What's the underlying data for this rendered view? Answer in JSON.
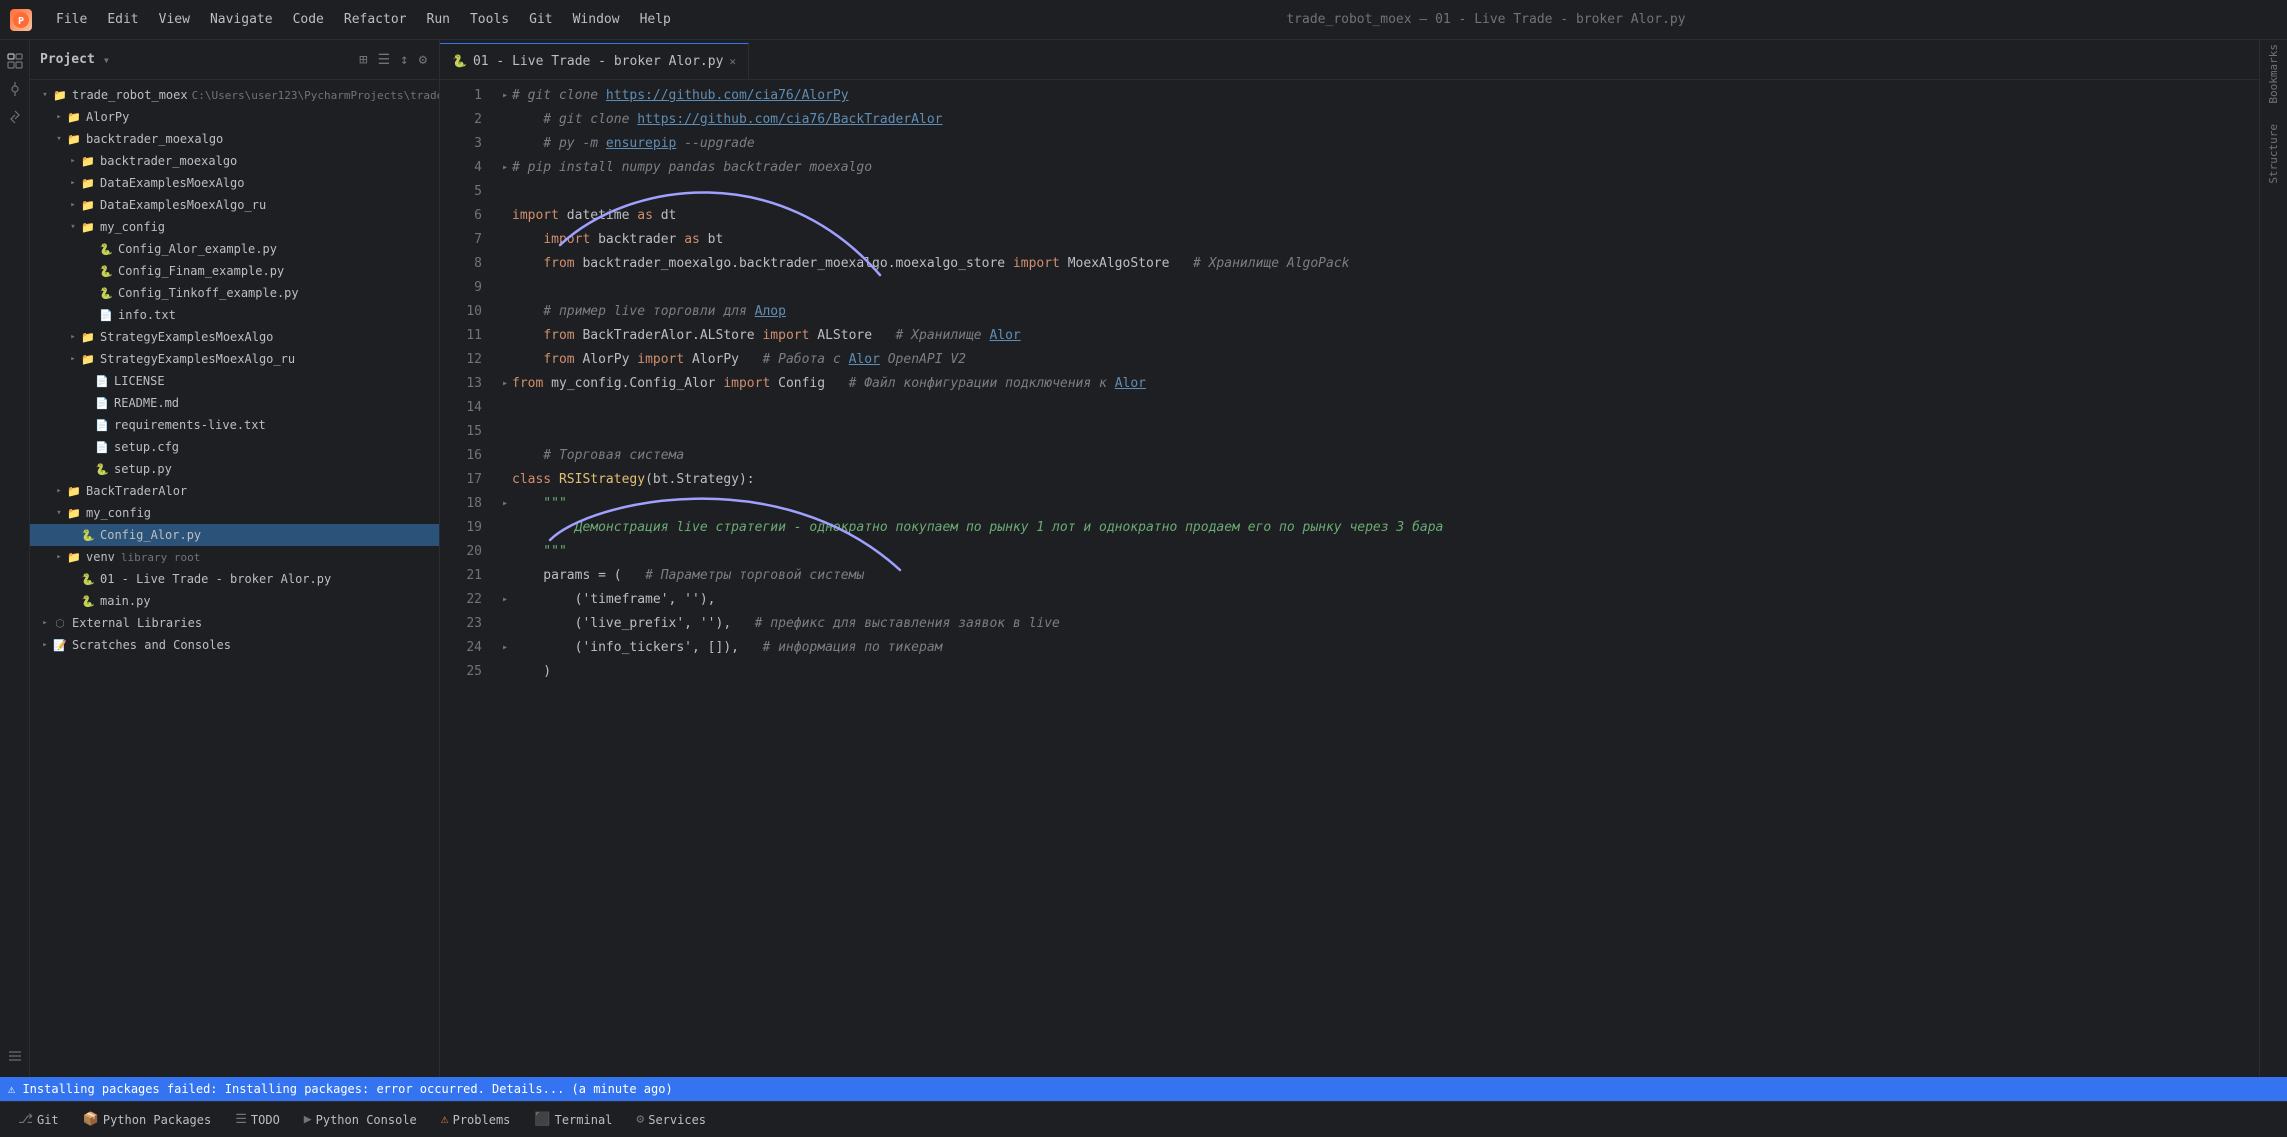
{
  "titlebar": {
    "logo": "PyCharm",
    "menus": [
      "File",
      "Edit",
      "View",
      "Navigate",
      "Code",
      "Refactor",
      "Run",
      "Tools",
      "Git",
      "Window",
      "Help"
    ],
    "title": "trade_robot_moex – 01 - Live Trade - broker Alor.py"
  },
  "breadcrumb": {
    "project": "trade_robot_moex",
    "separator": "›",
    "file": "01 - Live Trade - broker Alor.py"
  },
  "sidebar": {
    "title": "Project",
    "dropdown_icon": "▾",
    "icons": [
      "⊞",
      "☰",
      "↕",
      "⚙"
    ]
  },
  "project_tree": [
    {
      "id": "root",
      "label": "trade_robot_moex",
      "path": "C:\\Users\\user123\\PycharmProjects\\trade_",
      "indent": 0,
      "type": "folder",
      "expanded": true,
      "arrow": "▾"
    },
    {
      "id": "alorpy",
      "label": "AlorPy",
      "indent": 1,
      "type": "folder",
      "expanded": false,
      "arrow": "▸"
    },
    {
      "id": "backtrader",
      "label": "backtrader_moexalgo",
      "indent": 1,
      "type": "folder",
      "expanded": true,
      "arrow": "▾"
    },
    {
      "id": "backtrader_moexalgo",
      "label": "backtrader_moexalgo",
      "indent": 2,
      "type": "folder",
      "expanded": false,
      "arrow": "▸"
    },
    {
      "id": "dataexamples",
      "label": "DataExamplesMoexAlgo",
      "indent": 2,
      "type": "folder",
      "expanded": false,
      "arrow": "▸"
    },
    {
      "id": "dataexamples_ru",
      "label": "DataExamplesMoexAlgo_ru",
      "indent": 2,
      "type": "folder",
      "expanded": false,
      "arrow": "▸"
    },
    {
      "id": "my_config",
      "label": "my_config",
      "indent": 2,
      "type": "folder",
      "expanded": true,
      "arrow": "▾"
    },
    {
      "id": "config_alor",
      "label": "Config_Alor_example.py",
      "indent": 3,
      "type": "py",
      "arrow": ""
    },
    {
      "id": "config_finam",
      "label": "Config_Finam_example.py",
      "indent": 3,
      "type": "py",
      "arrow": ""
    },
    {
      "id": "config_tinkoff",
      "label": "Config_Tinkoff_example.py",
      "indent": 3,
      "type": "py",
      "arrow": ""
    },
    {
      "id": "info_txt",
      "label": "info.txt",
      "indent": 3,
      "type": "txt",
      "arrow": ""
    },
    {
      "id": "strategyexamples",
      "label": "StrategyExamplesMoexAlgo",
      "indent": 2,
      "type": "folder",
      "expanded": false,
      "arrow": "▸"
    },
    {
      "id": "strategyexamples_ru",
      "label": "StrategyExamplesMoexAlgo_ru",
      "indent": 2,
      "type": "folder",
      "expanded": false,
      "arrow": "▸"
    },
    {
      "id": "license",
      "label": "LICENSE",
      "indent": 2,
      "type": "txt",
      "arrow": ""
    },
    {
      "id": "readme",
      "label": "README.md",
      "indent": 2,
      "type": "md",
      "arrow": ""
    },
    {
      "id": "requirements",
      "label": "requirements-live.txt",
      "indent": 2,
      "type": "txt",
      "arrow": ""
    },
    {
      "id": "setup_cfg",
      "label": "setup.cfg",
      "indent": 2,
      "type": "cfg",
      "arrow": ""
    },
    {
      "id": "setup_py",
      "label": "setup.py",
      "indent": 2,
      "type": "py",
      "arrow": ""
    },
    {
      "id": "backtraderalor",
      "label": "BackTraderAlor",
      "indent": 1,
      "type": "folder",
      "expanded": false,
      "arrow": "▸"
    },
    {
      "id": "my_config2",
      "label": "my_config",
      "indent": 1,
      "type": "folder",
      "expanded": true,
      "arrow": "▾"
    },
    {
      "id": "config_alor_active",
      "label": "Config_Alor.py",
      "indent": 2,
      "type": "py",
      "arrow": "",
      "active": true
    },
    {
      "id": "venv",
      "label": "venv",
      "indent": 1,
      "type": "folder",
      "expanded": false,
      "arrow": "▸",
      "extra": "library root"
    },
    {
      "id": "live_trade",
      "label": "01 - Live Trade - broker Alor.py",
      "indent": 1,
      "type": "py",
      "arrow": ""
    },
    {
      "id": "main_py",
      "label": "main.py",
      "indent": 1,
      "type": "py",
      "arrow": ""
    },
    {
      "id": "external_libs",
      "label": "External Libraries",
      "indent": 0,
      "type": "folder_ext",
      "expanded": false,
      "arrow": "▸"
    },
    {
      "id": "scratches",
      "label": "Scratches and Consoles",
      "indent": 0,
      "type": "scratches",
      "expanded": false,
      "arrow": "▸"
    }
  ],
  "tabs": [
    {
      "label": "01 - Live Trade - broker Alor.py",
      "active": true,
      "closeable": true
    }
  ],
  "code": {
    "lines": [
      {
        "num": 1,
        "fold": "",
        "content": [
          {
            "t": "# git clone ",
            "cls": "c-comment"
          },
          {
            "t": "https://github.com/cia76/AlorPy",
            "cls": "c-url"
          }
        ]
      },
      {
        "num": 2,
        "fold": "",
        "content": [
          {
            "t": "    # git clone ",
            "cls": "c-comment"
          },
          {
            "t": "https://github.com/cia76/BackTraderAlor",
            "cls": "c-url"
          }
        ]
      },
      {
        "num": 3,
        "fold": "",
        "content": [
          {
            "t": "    # py -m ",
            "cls": "c-comment"
          },
          {
            "t": "ensurepip",
            "cls": "c-url"
          },
          {
            "t": " --upgrade",
            "cls": "c-comment"
          }
        ]
      },
      {
        "num": 4,
        "fold": "▸",
        "content": [
          {
            "t": "# pip install numpy pandas backtrader moexalgo",
            "cls": "c-comment"
          }
        ]
      },
      {
        "num": 5,
        "fold": "",
        "content": []
      },
      {
        "num": 6,
        "fold": "",
        "content": [
          {
            "t": "import",
            "cls": "c-import"
          },
          {
            "t": " datetime ",
            "cls": "c-normal"
          },
          {
            "t": "as",
            "cls": "c-as"
          },
          {
            "t": " dt",
            "cls": "c-normal"
          }
        ]
      },
      {
        "num": 7,
        "fold": "",
        "content": [
          {
            "t": "    import",
            "cls": "c-import"
          },
          {
            "t": " backtrader ",
            "cls": "c-normal"
          },
          {
            "t": "as",
            "cls": "c-as"
          },
          {
            "t": " bt",
            "cls": "c-normal"
          }
        ]
      },
      {
        "num": 8,
        "fold": "",
        "content": [
          {
            "t": "    from",
            "cls": "c-from"
          },
          {
            "t": " backtrader_moexalgo.backtrader_moexalgo.moexalgo_store ",
            "cls": "c-normal"
          },
          {
            "t": "import",
            "cls": "c-import"
          },
          {
            "t": " MoexAlgoStore   ",
            "cls": "c-normal"
          },
          {
            "t": "# Хранилище AlgoPack",
            "cls": "c-comment"
          }
        ]
      },
      {
        "num": 9,
        "fold": "",
        "content": []
      },
      {
        "num": 10,
        "fold": "",
        "content": [
          {
            "t": "    # пример live торговли для ",
            "cls": "c-comment"
          },
          {
            "t": "Алор",
            "cls": "c-url"
          }
        ]
      },
      {
        "num": 11,
        "fold": "",
        "content": [
          {
            "t": "    from",
            "cls": "c-from"
          },
          {
            "t": " BackTraderAlor.ALStore ",
            "cls": "c-normal"
          },
          {
            "t": "import",
            "cls": "c-import"
          },
          {
            "t": " ALStore   ",
            "cls": "c-normal"
          },
          {
            "t": "# Хранилище ",
            "cls": "c-comment"
          },
          {
            "t": "Alor",
            "cls": "c-url"
          }
        ]
      },
      {
        "num": 12,
        "fold": "",
        "content": [
          {
            "t": "    from",
            "cls": "c-from"
          },
          {
            "t": " AlorPy ",
            "cls": "c-normal"
          },
          {
            "t": "import",
            "cls": "c-import"
          },
          {
            "t": " AlorPy   ",
            "cls": "c-normal"
          },
          {
            "t": "# Работа с ",
            "cls": "c-comment"
          },
          {
            "t": "Alor",
            "cls": "c-url"
          },
          {
            "t": " OpenAPI V2",
            "cls": "c-comment"
          }
        ]
      },
      {
        "num": 13,
        "fold": "▸",
        "content": [
          {
            "t": "from",
            "cls": "c-from"
          },
          {
            "t": " my_config.Config_Alor ",
            "cls": "c-normal"
          },
          {
            "t": "import",
            "cls": "c-import"
          },
          {
            "t": " Config   ",
            "cls": "c-normal"
          },
          {
            "t": "# Файл конфигурации подключения к ",
            "cls": "c-comment"
          },
          {
            "t": "Alor",
            "cls": "c-url"
          }
        ]
      },
      {
        "num": 14,
        "fold": "",
        "content": []
      },
      {
        "num": 15,
        "fold": "",
        "content": []
      },
      {
        "num": 16,
        "fold": "",
        "content": [
          {
            "t": "    # Торговая система",
            "cls": "c-comment"
          }
        ]
      },
      {
        "num": 17,
        "fold": "",
        "content": [
          {
            "t": "class",
            "cls": "c-keyword"
          },
          {
            "t": " RSIStrategy",
            "cls": "c-class"
          },
          {
            "t": "(bt.Strategy):",
            "cls": "c-normal"
          }
        ]
      },
      {
        "num": 18,
        "fold": "▸",
        "content": [
          {
            "t": "    \"\"\"",
            "cls": "c-string"
          }
        ]
      },
      {
        "num": 19,
        "fold": "",
        "content": [
          {
            "t": "        ",
            "cls": "c-normal"
          },
          {
            "t": "Демонстрация live стратегии - однократно покупаем по рынку 1 лот и однократно продаем его по рынку через 3 бара",
            "cls": "c-green-italic"
          }
        ]
      },
      {
        "num": 20,
        "fold": "",
        "content": [
          {
            "t": "    \"\"\"",
            "cls": "c-string"
          }
        ]
      },
      {
        "num": 21,
        "fold": "",
        "content": [
          {
            "t": "    params = (   ",
            "cls": "c-normal"
          },
          {
            "t": "# Параметры торговой системы",
            "cls": "c-comment"
          }
        ]
      },
      {
        "num": 22,
        "fold": "▸",
        "content": [
          {
            "t": "        ('timeframe', ''),",
            "cls": "c-normal"
          }
        ]
      },
      {
        "num": 23,
        "fold": "",
        "content": [
          {
            "t": "        ('live_prefix', ''),   ",
            "cls": "c-normal"
          },
          {
            "t": "# префикс для выставления заявок в live",
            "cls": "c-comment"
          }
        ]
      },
      {
        "num": 24,
        "fold": "▸",
        "content": [
          {
            "t": "        ('info_tickers', []),   ",
            "cls": "c-normal"
          },
          {
            "t": "# информация по тикерам",
            "cls": "c-comment"
          }
        ]
      },
      {
        "num": 25,
        "fold": "",
        "content": [
          {
            "t": "    )",
            "cls": "c-normal"
          }
        ]
      }
    ]
  },
  "bottom_toolbar": {
    "items": [
      {
        "icon": "⎇",
        "label": "Git",
        "id": "git"
      },
      {
        "icon": "📦",
        "label": "Python Packages",
        "id": "python-packages"
      },
      {
        "icon": "☰",
        "label": "TODO",
        "id": "todo"
      },
      {
        "icon": "▶",
        "label": "Python Console",
        "id": "python-console"
      },
      {
        "icon": "⚠",
        "label": "Problems",
        "id": "problems"
      },
      {
        "icon": "⬛",
        "label": "Terminal",
        "id": "terminal"
      },
      {
        "icon": "⚙",
        "label": "Services",
        "id": "services"
      }
    ]
  },
  "status_bar": {
    "text": "⚠ Installing packages failed: Installing packages: error occurred. Details... (a minute ago)"
  },
  "activity_bar": {
    "icons": [
      {
        "name": "project",
        "glyph": "📁"
      },
      {
        "name": "commit",
        "glyph": "⎇"
      },
      {
        "name": "pull-requests",
        "glyph": "⇅"
      },
      {
        "name": "structure",
        "glyph": "≡"
      }
    ]
  }
}
